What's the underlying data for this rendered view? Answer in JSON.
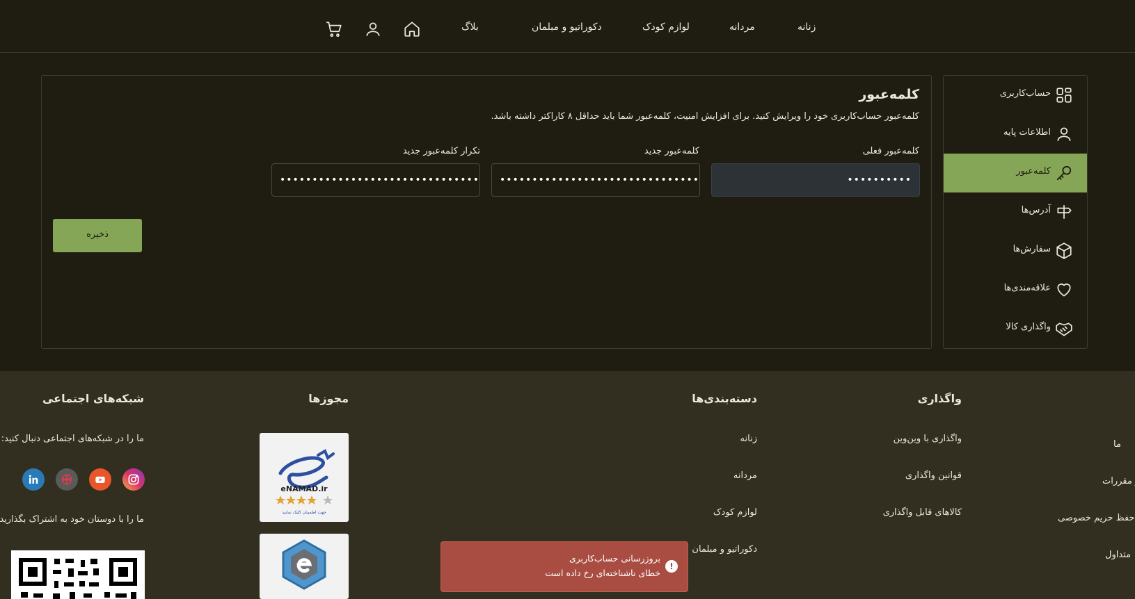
{
  "nav": {
    "links": [
      "زنانه",
      "مردانه",
      "لوازم کودک",
      "دکوراتیو و مبلمان",
      "بلاگ"
    ],
    "icons": [
      "home-icon",
      "user-icon",
      "cart-icon"
    ]
  },
  "sidebar": {
    "items": [
      {
        "label": "حساب‌کاربری",
        "icon": "grid-icon"
      },
      {
        "label": "اطلاعات پایه",
        "icon": "user-icon"
      },
      {
        "label": "کلمه‌عبور",
        "icon": "key-icon",
        "active": true
      },
      {
        "label": "آدرس‌ها",
        "icon": "signpost-icon"
      },
      {
        "label": "سفارش‌ها",
        "icon": "box-icon"
      },
      {
        "label": "علاقه‌مندی‌ها",
        "icon": "heart-icon"
      },
      {
        "label": "واگذاری کالا",
        "icon": "handshake-icon"
      }
    ]
  },
  "password_form": {
    "title": "کلمه‌عبور",
    "description": "کلمه‌عبور حساب‌کاربری خود را ویرایش کنید. برای افزایش امنیت، کلمه‌عبور شما باید حداقل ۸ کاراکتر داشته باشد.",
    "current_label": "کلمه‌عبور فعلی",
    "current_value": "••••••••••",
    "new_label": "کلمه‌عبور جدید",
    "new_value": "••••••••••••••••••••••••••••••••••••••••••",
    "repeat_label": "تکرار کلمه‌عبور جدید",
    "repeat_value": "••••••••••••••••••••••••••••••••••••••••••",
    "save_label": "ذخیره"
  },
  "footer": {
    "col1_head_partial": "‌",
    "col1_links": [
      "ما",
      "و مقررات",
      "حفظ حریم خصوصی",
      "متداول"
    ],
    "handover_head": "واگذاری",
    "handover_links": [
      "واگذاری با وین‌وین",
      "قوانین واگذاری",
      "کالاهای قابل واگذاری"
    ],
    "categories_head": "دسته‌بندی‌ها",
    "categories_links": [
      "زنانه",
      "مردانه",
      "لوازم کودک",
      "دکوراتیو و مبلمان"
    ],
    "licenses_head": "مجوزها",
    "enamad_text": "eNAMAD.ir",
    "enamad_caption": "جهت اطمینان کلیک نمایید",
    "social_head": "شبکه‌های اجتماعی",
    "social_follow": "ما را در شبکه‌های اجتماعی دنبال کنید:",
    "social_share": "ما را با دوستان خود به اشتراک بگذارید",
    "social_icons": [
      "instagram-icon",
      "youtube-icon",
      "aparat-icon",
      "linkedin-icon"
    ]
  },
  "toast": {
    "title": "بروزرسانی حساب‌کاربری",
    "message": "خطای ناشناخته‌ای رخ داده است"
  },
  "colors": {
    "background": "#1f1d12",
    "footer": "#322f21",
    "accent": "#84a656",
    "toast": "#a94d42"
  }
}
